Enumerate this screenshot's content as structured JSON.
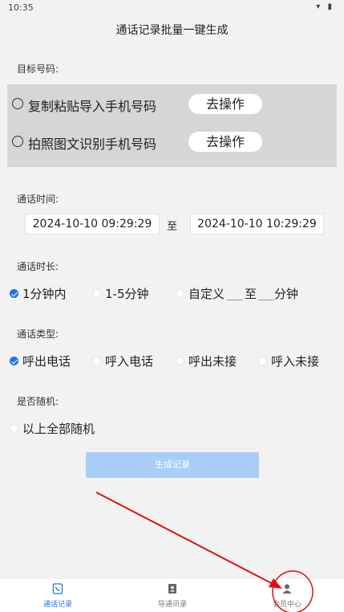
{
  "status": {
    "time": "10:35",
    "icons": "▾ ▮"
  },
  "title": "通话记录批量一键生成",
  "target": {
    "label": "目标号码:",
    "options": [
      {
        "text": "复制粘贴导入手机号码",
        "button": "去操作"
      },
      {
        "text": "拍照图文识别手机号码",
        "button": "去操作"
      }
    ]
  },
  "call_time": {
    "label": "通话时间:",
    "start": "2024-10-10 09:29:29",
    "sep": "至",
    "end": "2024-10-10 10:29:29"
  },
  "duration": {
    "label": "通话时长:",
    "options": [
      "1分钟内",
      "1-5分钟",
      "自定义"
    ],
    "custom_sep": "至",
    "custom_unit": "分钟",
    "selected": 0
  },
  "call_type": {
    "label": "通话类型:",
    "options": [
      "呼出电话",
      "呼入电话",
      "呼出未接",
      "呼入未接"
    ],
    "selected": 0
  },
  "random": {
    "label": "是否随机:",
    "option": "以上全部随机"
  },
  "generate_button": "生成记录",
  "tabs": [
    {
      "label": "通话记录",
      "icon": "phone-icon",
      "active": true
    },
    {
      "label": "导通讯录",
      "icon": "contacts-icon",
      "active": false
    },
    {
      "label": "会员中心",
      "icon": "user-icon",
      "active": false
    }
  ],
  "colors": {
    "accent": "#1e74e6",
    "annotation": "#e01010",
    "button_disabled": "#a8cdf6"
  }
}
